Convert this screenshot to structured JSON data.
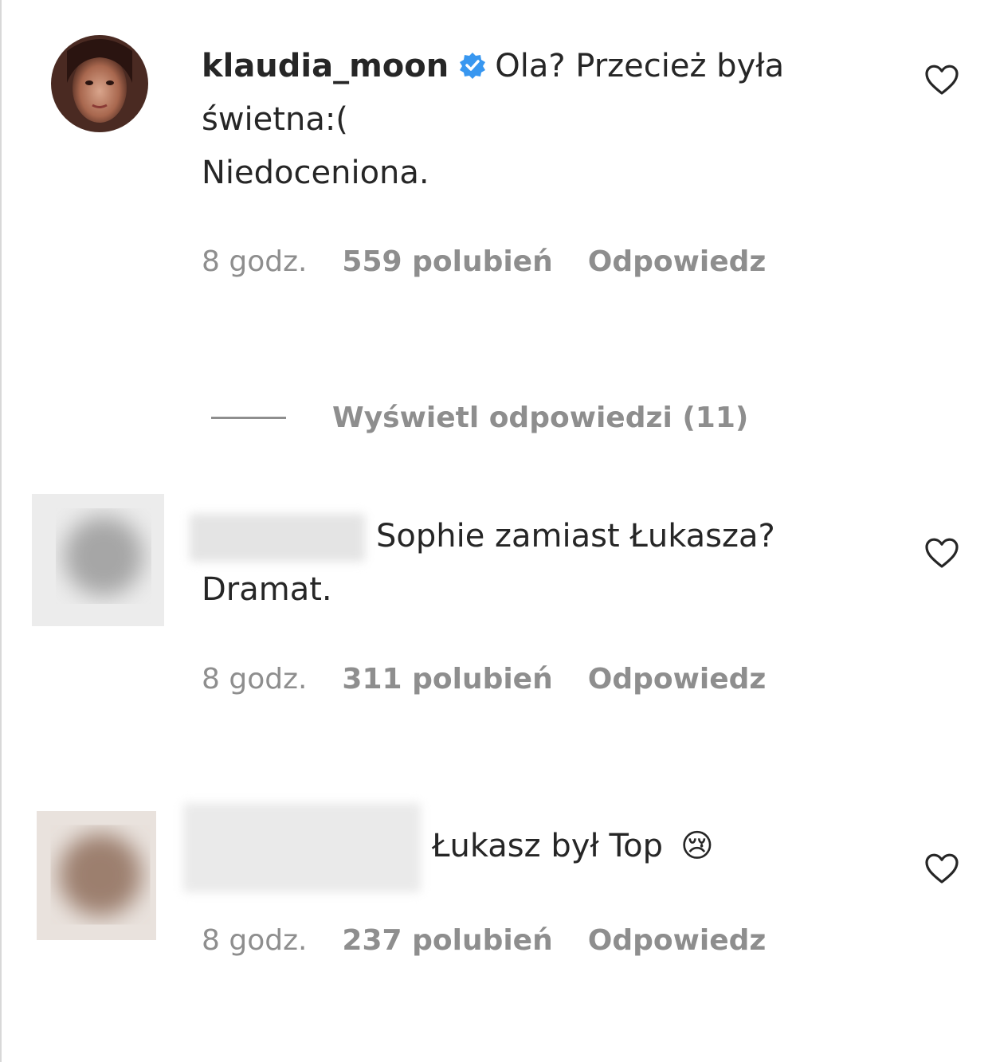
{
  "comments": [
    {
      "username": "klaudia_moon",
      "verified": true,
      "text_line1": "Ola? Przecież była",
      "text_line2": "świetna:(",
      "text_line3": "Niedoceniona.",
      "time": "8 godz.",
      "likes": "559 polubień",
      "reply": "Odpowiedz"
    },
    {
      "username": "",
      "text_line1": "Sophie zamiast Łukasza?",
      "text_line2": "Dramat.",
      "time": "8 godz.",
      "likes": "311 polubień",
      "reply": "Odpowiedz"
    },
    {
      "username": "",
      "text_line1": "Łukasz był Top",
      "emoji": "😢",
      "time": "8 godz.",
      "likes": "237 polubień",
      "reply": "Odpowiedz"
    }
  ],
  "view_replies": "Wyświetl odpowiedzi (11)",
  "icons": {
    "like": "heart-outline-icon",
    "verified": "verified-badge-icon"
  },
  "colors": {
    "text": "#262626",
    "secondary": "#8e8e8e",
    "verified": "#3897f0"
  }
}
